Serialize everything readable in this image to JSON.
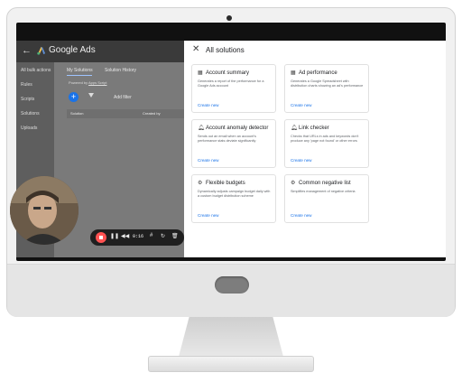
{
  "app": {
    "name": "Google Ads",
    "nav": [
      "All bulk actions",
      "Rules",
      "Scripts",
      "Solutions",
      "Uploads"
    ],
    "tabs": [
      "My Solutions",
      "Solution History"
    ],
    "powered_prefix": "Powered by",
    "powered_by": "Apps Script",
    "add_filter": "Add filter",
    "table_headers": [
      "Solution",
      "Created by"
    ]
  },
  "panel": {
    "title": "All solutions",
    "cards": [
      {
        "title": "Account summary",
        "icon": "table-icon",
        "description": "Generates a report of the performance for a Google Ads account",
        "link": "Create new"
      },
      {
        "title": "Ad performance",
        "icon": "table-icon",
        "description": "Generates a Google Spreadsheet with distribution charts showing an ad's performance",
        "link": "Create new"
      },
      {
        "title": "Account anomaly detector",
        "icon": "bell-icon",
        "description": "Sends out an email when an account's performance stats deviate significantly",
        "link": "Create new"
      },
      {
        "title": "Link checker",
        "icon": "bell-icon",
        "description": "Checks that URLs in ads and keywords don't produce any 'page not found' or other errors",
        "link": "Create new"
      },
      {
        "title": "Flexible budgets",
        "icon": "gear-icon",
        "description": "Dynamically adjusts campaign budget daily with a custom budget distribution scheme",
        "link": "Create new"
      },
      {
        "title": "Common negative list",
        "icon": "gear-icon",
        "description": "Simplifies management of negative criteria",
        "link": "Create new"
      }
    ]
  },
  "recorder": {
    "time": "0:16"
  },
  "colors": {
    "accent": "#1a73e8",
    "record": "#ff5252"
  }
}
